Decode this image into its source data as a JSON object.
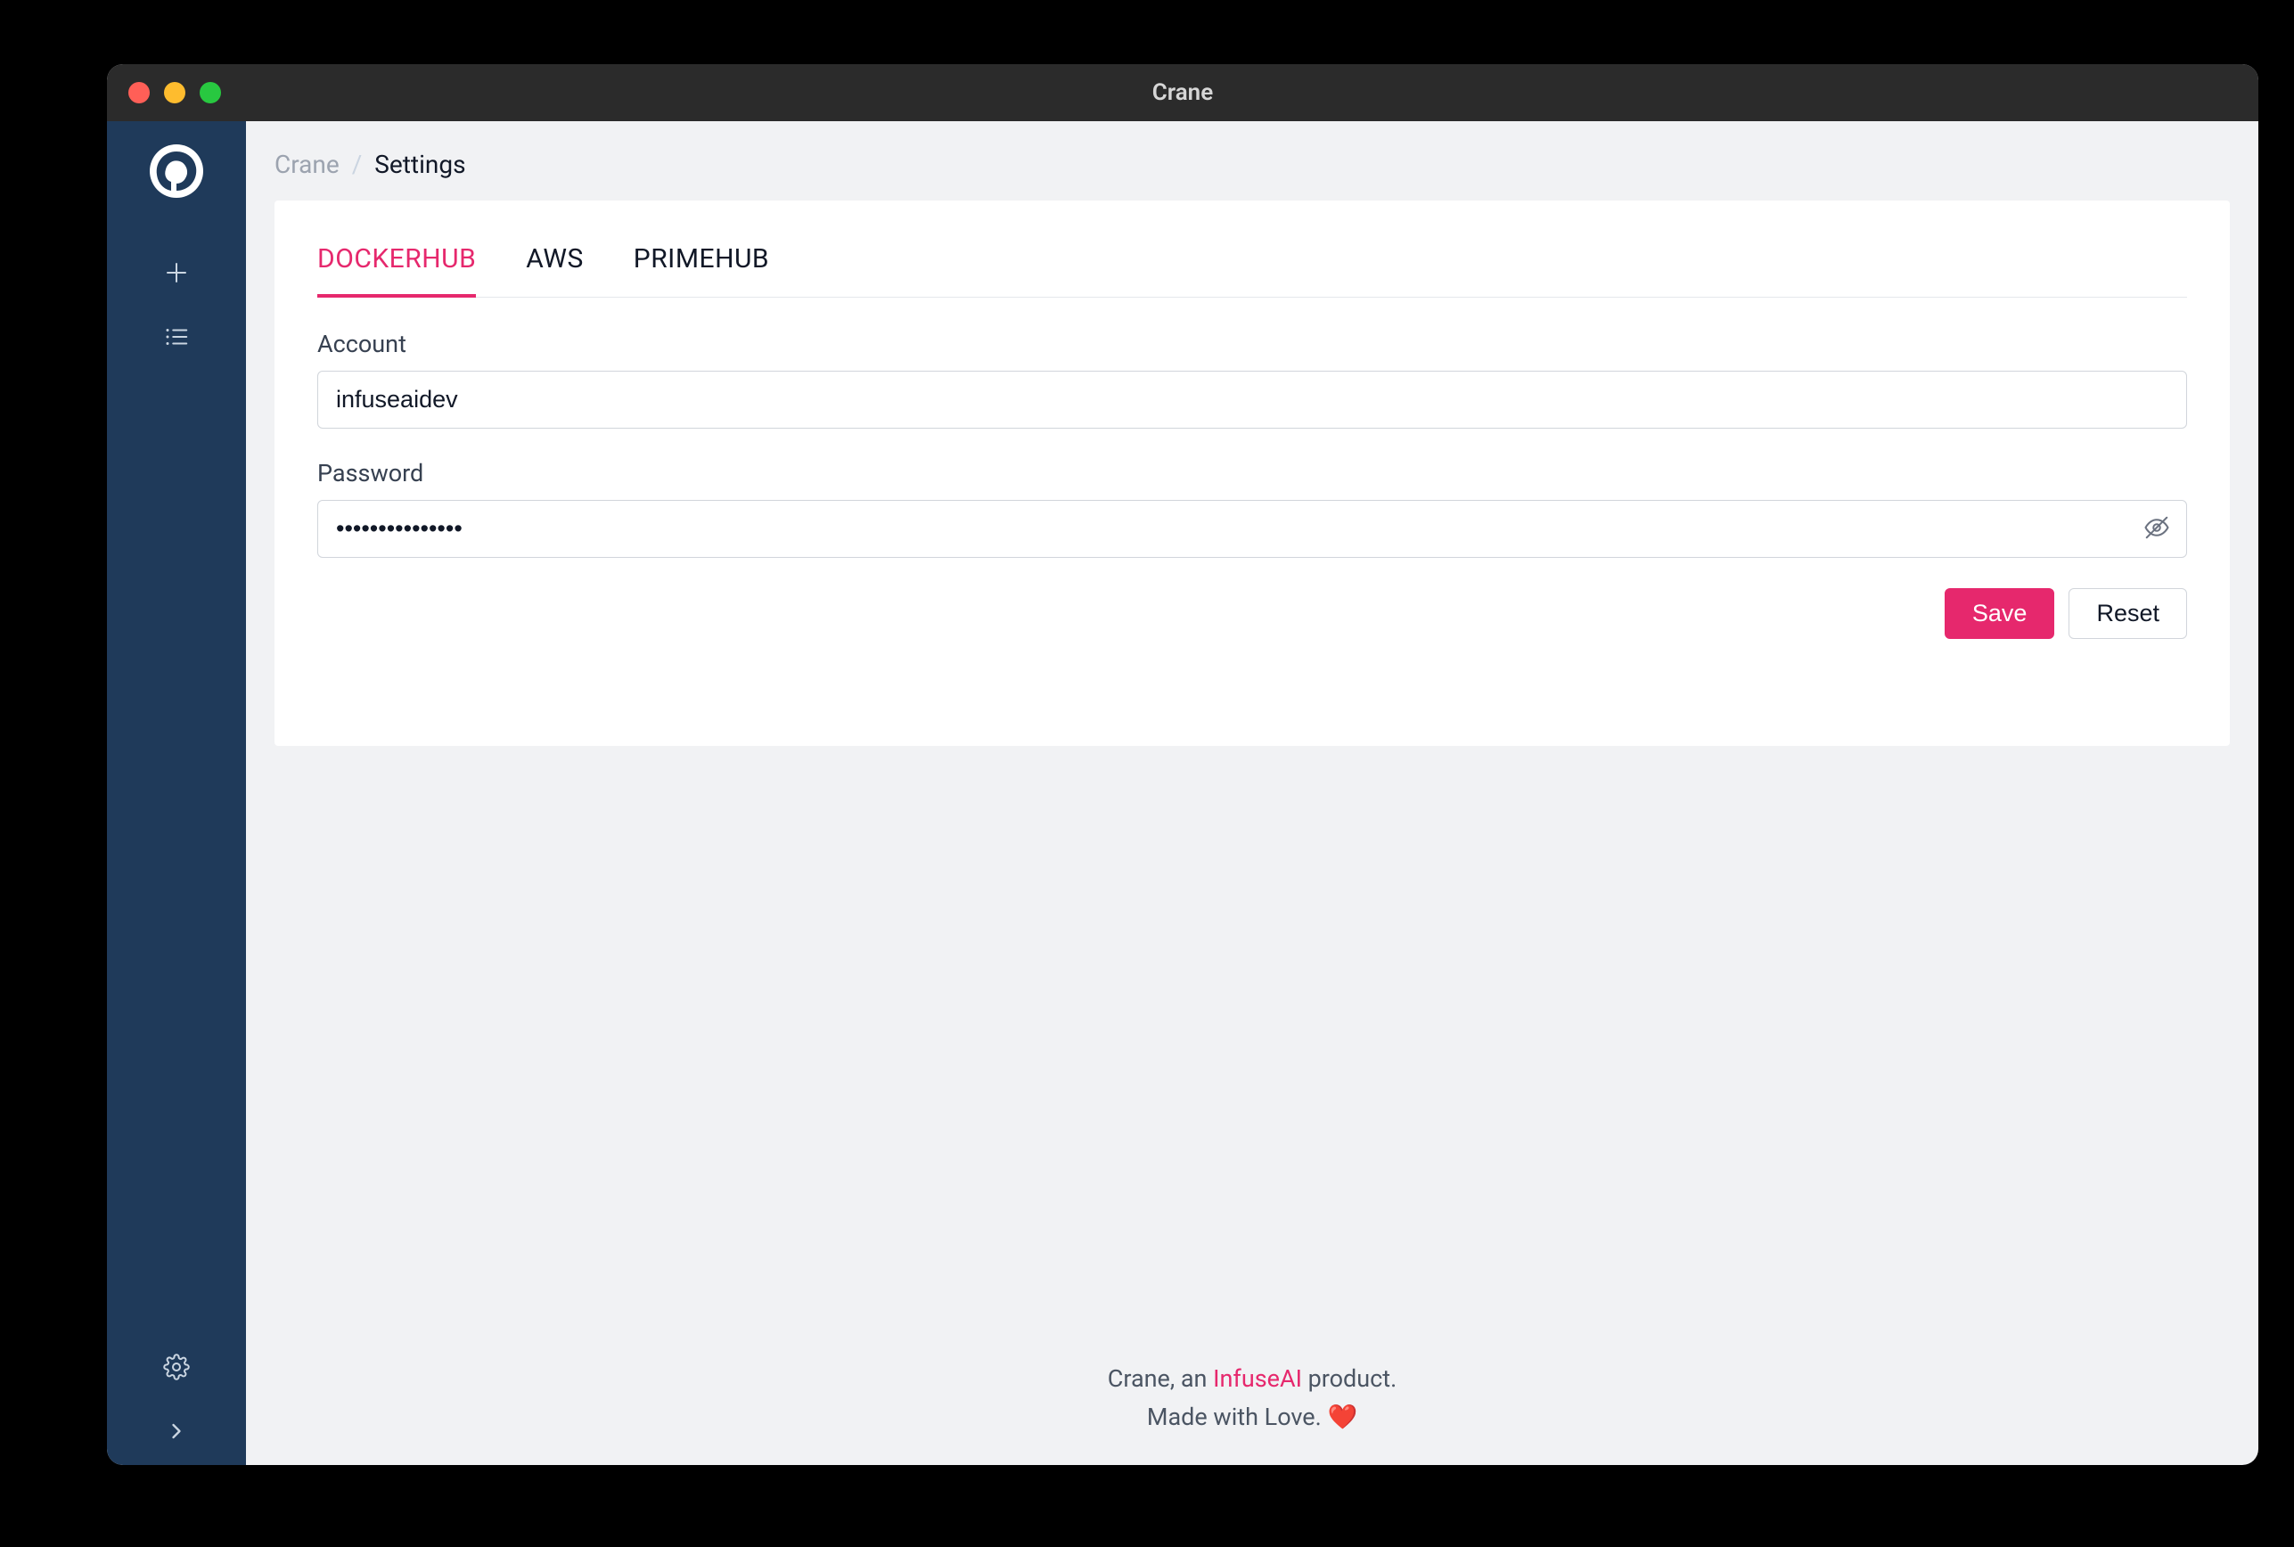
{
  "titlebar": {
    "title": "Crane"
  },
  "breadcrumb": {
    "root": "Crane",
    "separator": "/",
    "current": "Settings"
  },
  "tabs": [
    {
      "key": "dockerhub",
      "label": "DOCKERHUB",
      "active": true
    },
    {
      "key": "aws",
      "label": "AWS",
      "active": false
    },
    {
      "key": "primehub",
      "label": "PRIMEHUB",
      "active": false
    }
  ],
  "form": {
    "account_label": "Account",
    "account_value": "infuseaidev",
    "password_label": "Password",
    "password_value": "•••••••••••••••"
  },
  "buttons": {
    "save": "Save",
    "reset": "Reset"
  },
  "footer": {
    "line1_pre": "Crane, an ",
    "line1_link": "InfuseAI",
    "line1_post": " product.",
    "line2": "Made with Love. ",
    "heart": "❤️"
  },
  "colors": {
    "accent": "#e6286d",
    "sidebar_bg": "#1f3a5a",
    "titlebar_bg": "#2b2b2b",
    "page_bg": "#f1f2f4"
  },
  "sidebar": {
    "items": [
      {
        "icon": "plus-icon",
        "name": "sidebar-add"
      },
      {
        "icon": "list-icon",
        "name": "sidebar-list"
      }
    ],
    "bottom": [
      {
        "icon": "gear-icon",
        "name": "sidebar-settings",
        "active": true
      },
      {
        "icon": "chevron-right-icon",
        "name": "sidebar-expand"
      }
    ]
  }
}
